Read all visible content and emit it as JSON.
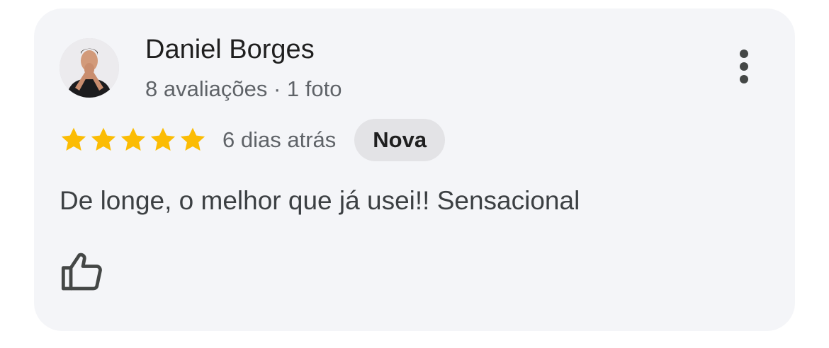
{
  "review": {
    "author": {
      "name": "Daniel Borges",
      "meta": "8 avaliações · 1 foto",
      "avatar_icon": "person-photo-avatar"
    },
    "rating": {
      "stars": 5,
      "max_stars": 5,
      "star_color": "#fbbc04"
    },
    "date": "6 dias atrás",
    "badge": "Nova",
    "text": "De longe, o melhor que já usei!! Sensacional",
    "actions": {
      "more_icon": "more-vertical-icon",
      "like_icon": "thumbs-up-icon"
    }
  },
  "colors": {
    "card_background": "#f4f5f8",
    "badge_background": "#e3e3e6",
    "primary_text": "#1f1f1f",
    "secondary_text": "#5f6368",
    "icon": "#444746"
  }
}
